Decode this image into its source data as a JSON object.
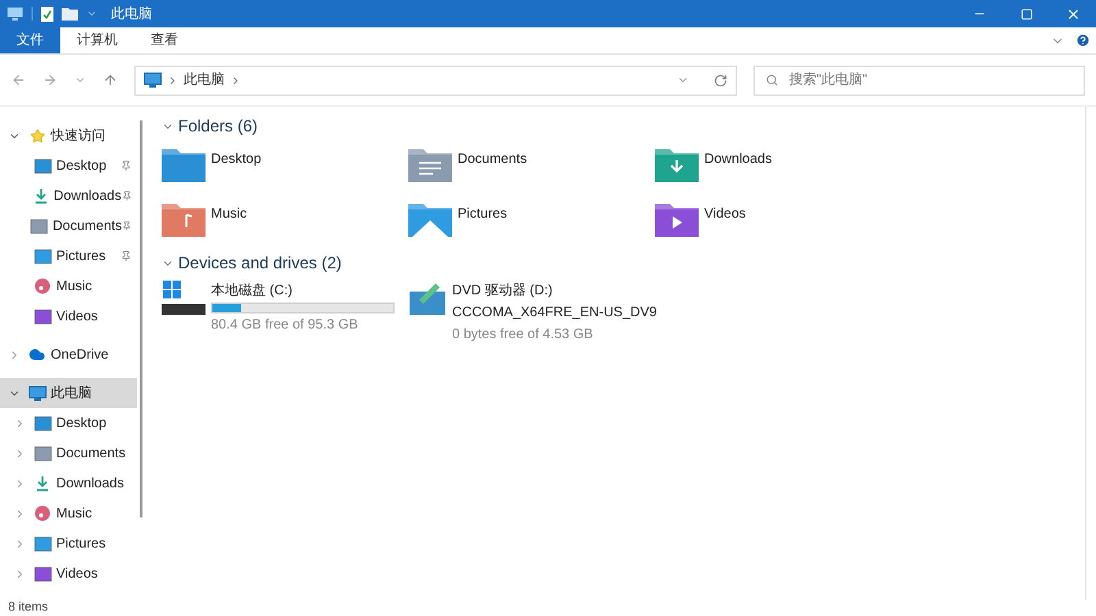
{
  "window": {
    "title": "此电脑"
  },
  "ribbon_tabs": [
    {
      "label": "文件",
      "selected": true
    },
    {
      "label": "计算机",
      "selected": false
    },
    {
      "label": "查看",
      "selected": false
    }
  ],
  "address": {
    "path": [
      "此电脑"
    ]
  },
  "search": {
    "placeholder": "搜索\"此电脑\""
  },
  "sidebar": {
    "items": [
      {
        "label": "快速访问",
        "kind": "star",
        "expanded": true,
        "selected": false,
        "children": [
          {
            "label": "Desktop",
            "kind": "desktop",
            "pinned": true
          },
          {
            "label": "Downloads",
            "kind": "downloads",
            "pinned": true
          },
          {
            "label": "Documents",
            "kind": "documents",
            "pinned": true
          },
          {
            "label": "Pictures",
            "kind": "pictures",
            "pinned": true
          },
          {
            "label": "Music",
            "kind": "music",
            "pinned": false
          },
          {
            "label": "Videos",
            "kind": "videos",
            "pinned": false
          }
        ]
      },
      {
        "label": "OneDrive",
        "kind": "cloud",
        "expanded": false,
        "selected": false
      },
      {
        "label": "此电脑",
        "kind": "pc",
        "expanded": true,
        "selected": true,
        "children": [
          {
            "label": "Desktop",
            "kind": "desktop",
            "expanded": false
          },
          {
            "label": "Documents",
            "kind": "documents",
            "expanded": false
          },
          {
            "label": "Downloads",
            "kind": "downloads",
            "expanded": false
          },
          {
            "label": "Music",
            "kind": "music",
            "expanded": false
          },
          {
            "label": "Pictures",
            "kind": "pictures",
            "expanded": false
          },
          {
            "label": "Videos",
            "kind": "videos",
            "expanded": false
          }
        ]
      }
    ]
  },
  "folders": {
    "heading": "Folders (6)",
    "expanded": true,
    "items": [
      {
        "label": "Desktop",
        "kind": "desktop"
      },
      {
        "label": "Documents",
        "kind": "documents"
      },
      {
        "label": "Downloads",
        "kind": "downloads"
      },
      {
        "label": "Music",
        "kind": "music"
      },
      {
        "label": "Pictures",
        "kind": "pictures"
      },
      {
        "label": "Videos",
        "kind": "videos"
      }
    ]
  },
  "drives": {
    "heading": "Devices and drives (2)",
    "expanded": true,
    "items": [
      {
        "label": "本地磁盘 (C:)",
        "kind": "disk",
        "level": 0.16,
        "detail": "80.4 GB free of 95.3 GB"
      },
      {
        "label": "DVD 驱动器 (D:)",
        "kind": "dvd",
        "volume": "CCCOMA_X64FRE_EN-US_DV9",
        "detail": "0 bytes free of 4.53 GB"
      }
    ]
  },
  "status_bar": {
    "count": "8 items"
  }
}
